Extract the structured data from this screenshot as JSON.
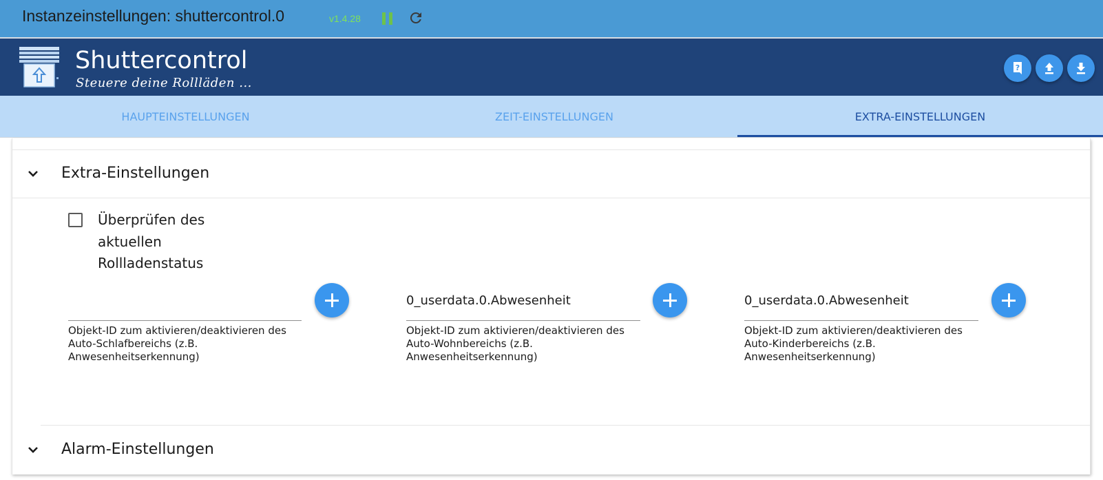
{
  "window": {
    "title": "Instanzeinstellungen: shuttercontrol.0",
    "version": "v1.4.28"
  },
  "header": {
    "app_title": "Shuttercontrol",
    "app_subtitle": "Steuere deine Rollläden ..."
  },
  "tabs": [
    {
      "label": "HAUPTEINSTELLUNGEN",
      "active": false
    },
    {
      "label": "ZEIT-EINSTELLUNGEN",
      "active": false
    },
    {
      "label": "EXTRA-EINSTELLUNGEN",
      "active": true
    }
  ],
  "sections": {
    "extra": {
      "title": "Extra-Einstellungen",
      "checkbox": {
        "label": "Überprüfen des aktuellen Rollladenstatus",
        "checked": false
      },
      "fields": [
        {
          "value": "",
          "helper": "Objekt-ID zum aktivieren/deaktivieren des Auto-Schlafbereichs (z.B. Anwesenheitserkennung)"
        },
        {
          "value": "0_userdata.0.Abwesenheit",
          "helper": "Objekt-ID zum aktivieren/deaktivieren des Auto-Wohnbereichs (z.B. Anwesenheitserkennung)"
        },
        {
          "value": "0_userdata.0.Abwesenheit",
          "helper": "Objekt-ID zum aktivieren/deaktivieren des Auto-Kinderbereichs (z.B. Anwesenheitserkennung)"
        }
      ]
    },
    "alarm": {
      "title": "Alarm-Einstellungen"
    }
  },
  "colors": {
    "titlebar_bg": "#4a9ad4",
    "header_bg": "#1f4379",
    "tabs_bg": "#bbdaf8",
    "tab_active": "#1d4ea1",
    "tab_inactive": "#5aa2ec",
    "fab": "#3a96ee"
  },
  "icons": {
    "pause": "pause-icon",
    "reload": "reload-icon",
    "help": "help-icon",
    "upload": "upload-icon",
    "download": "download-icon",
    "chevron": "chevron-down-icon",
    "add": "plus-icon"
  }
}
